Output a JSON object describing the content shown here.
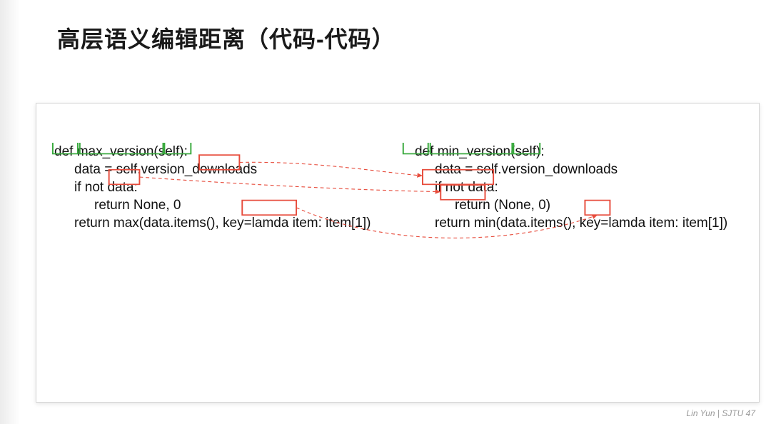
{
  "title": "高层语义编辑距离（代码-代码）",
  "code_left": {
    "l1": "def max_version(self):",
    "l2": "data = self.version_downloads",
    "l3": "if not data:",
    "l4": "return None, 0",
    "l5": "return max(data.items(), key=lamda item: item[1])"
  },
  "code_right": {
    "l1": "def min_version(self):",
    "l2": "data = self.version_downloads",
    "l3": "if not data:",
    "l4": "return (None, 0)",
    "l5": "return min(data.items(), key=lamda item: item[1])"
  },
  "footer": "Lin Yun | SJTU 47",
  "colors": {
    "green": "#37a93c",
    "red": "#e74c3c"
  }
}
